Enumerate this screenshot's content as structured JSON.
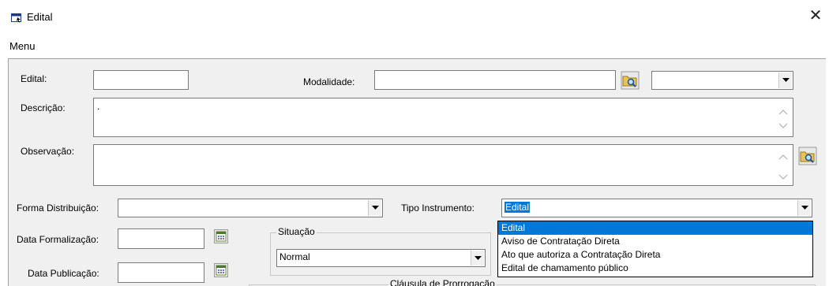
{
  "window": {
    "title": "Edital",
    "close_glyph": "✕"
  },
  "menu": {
    "items": [
      "Menu"
    ]
  },
  "form": {
    "edital_label": "Edital:",
    "edital_value": "",
    "modalidade_label": "Modalidade:",
    "modalidade_value": "",
    "modalidade_combo_value": "",
    "descricao_label": "Descrição:",
    "descricao_value": ".",
    "observacao_label": "Observação:",
    "observacao_value": "",
    "forma_distribuicao_label": "Forma Distribuição:",
    "forma_distribuicao_value": "",
    "tipo_instrumento_label": "Tipo Instrumento:",
    "tipo_instrumento_value": "Edital",
    "data_formalizacao_label": "Data Formalização:",
    "data_formalizacao_value": "",
    "data_publicacao_label": "Data Publicação:",
    "data_publicacao_value": "",
    "situacao_group_label": "Situação",
    "situacao_value": "Normal",
    "clausula_group_label": "Cláusula de Prorrogação"
  },
  "tipo_instrumento_options": [
    "Edital",
    "Aviso de Contratação Direta",
    "Ato que autoriza a Contratação Direta",
    "Edital de chamamento público"
  ],
  "icons": {
    "app": "window-icon",
    "search": "search-folder-icon",
    "calendar": "calendar-icon",
    "dropdown": "chevron-down-icon"
  },
  "colors": {
    "selection": "#0078d7",
    "panel": "#f0f0f0"
  }
}
